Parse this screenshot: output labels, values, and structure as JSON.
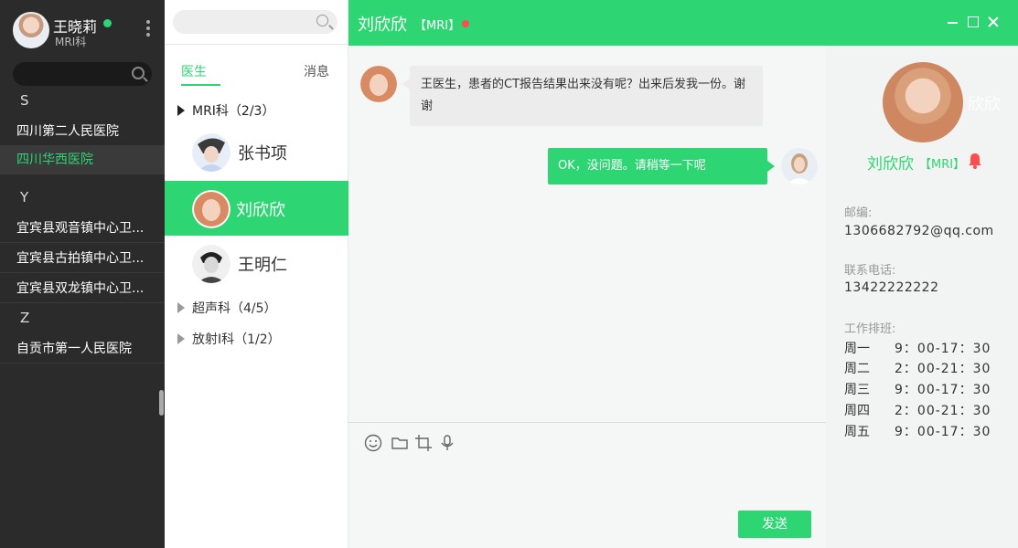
{
  "user": {
    "name": "王晓莉",
    "dept": "MRI科"
  },
  "hospital_list": {
    "letters": [
      "S",
      "Y",
      "Z"
    ],
    "s_items": [
      "四川第二人民医院",
      "四川华西医院"
    ],
    "y_items": [
      "宜宾县观音镇中心卫...",
      "宜宾县古拍镇中心卫...",
      "宜宾县双龙镇中心卫..."
    ],
    "z_items": [
      "自贡市第一人民医院"
    ]
  },
  "tabs": {
    "doctors": "医生",
    "messages": "消息"
  },
  "groups": {
    "mri": "MRI科（2/3）",
    "ultrasound": "超声科（4/5）",
    "radiology": "放射I科（1/2）"
  },
  "contacts": [
    "张书项",
    "刘欣欣",
    "王明仁"
  ],
  "chat": {
    "title": "刘欣欣",
    "tag": "【MRI】",
    "incoming": "王医生，患者的CT报告结果出来没有呢？出来后发我一份。谢谢",
    "outgoing": "OK，没问题。请稍等一下呢",
    "send_label": "发送"
  },
  "profile": {
    "name": "刘欣欣",
    "tag": "【MRI】",
    "overlay_text": "欣欣",
    "email_label": "邮编:",
    "email": "1306682792@qq.com",
    "phone_label": "联系电话:",
    "phone": "13422222222",
    "schedule_label": "工作排班:",
    "schedule": [
      {
        "day": "周一",
        "time": "9：00-17：30"
      },
      {
        "day": "周二",
        "time": "2：00-21：30"
      },
      {
        "day": "周三",
        "time": "9：00-17：30"
      },
      {
        "day": "周四",
        "time": "2：00-21：30"
      },
      {
        "day": "周五",
        "time": "9：00-17：30"
      }
    ]
  },
  "colors": {
    "accent": "#2ed573",
    "dark": "#2b2b2b",
    "online": "#2ed573",
    "alert": "#ff4d4f"
  }
}
